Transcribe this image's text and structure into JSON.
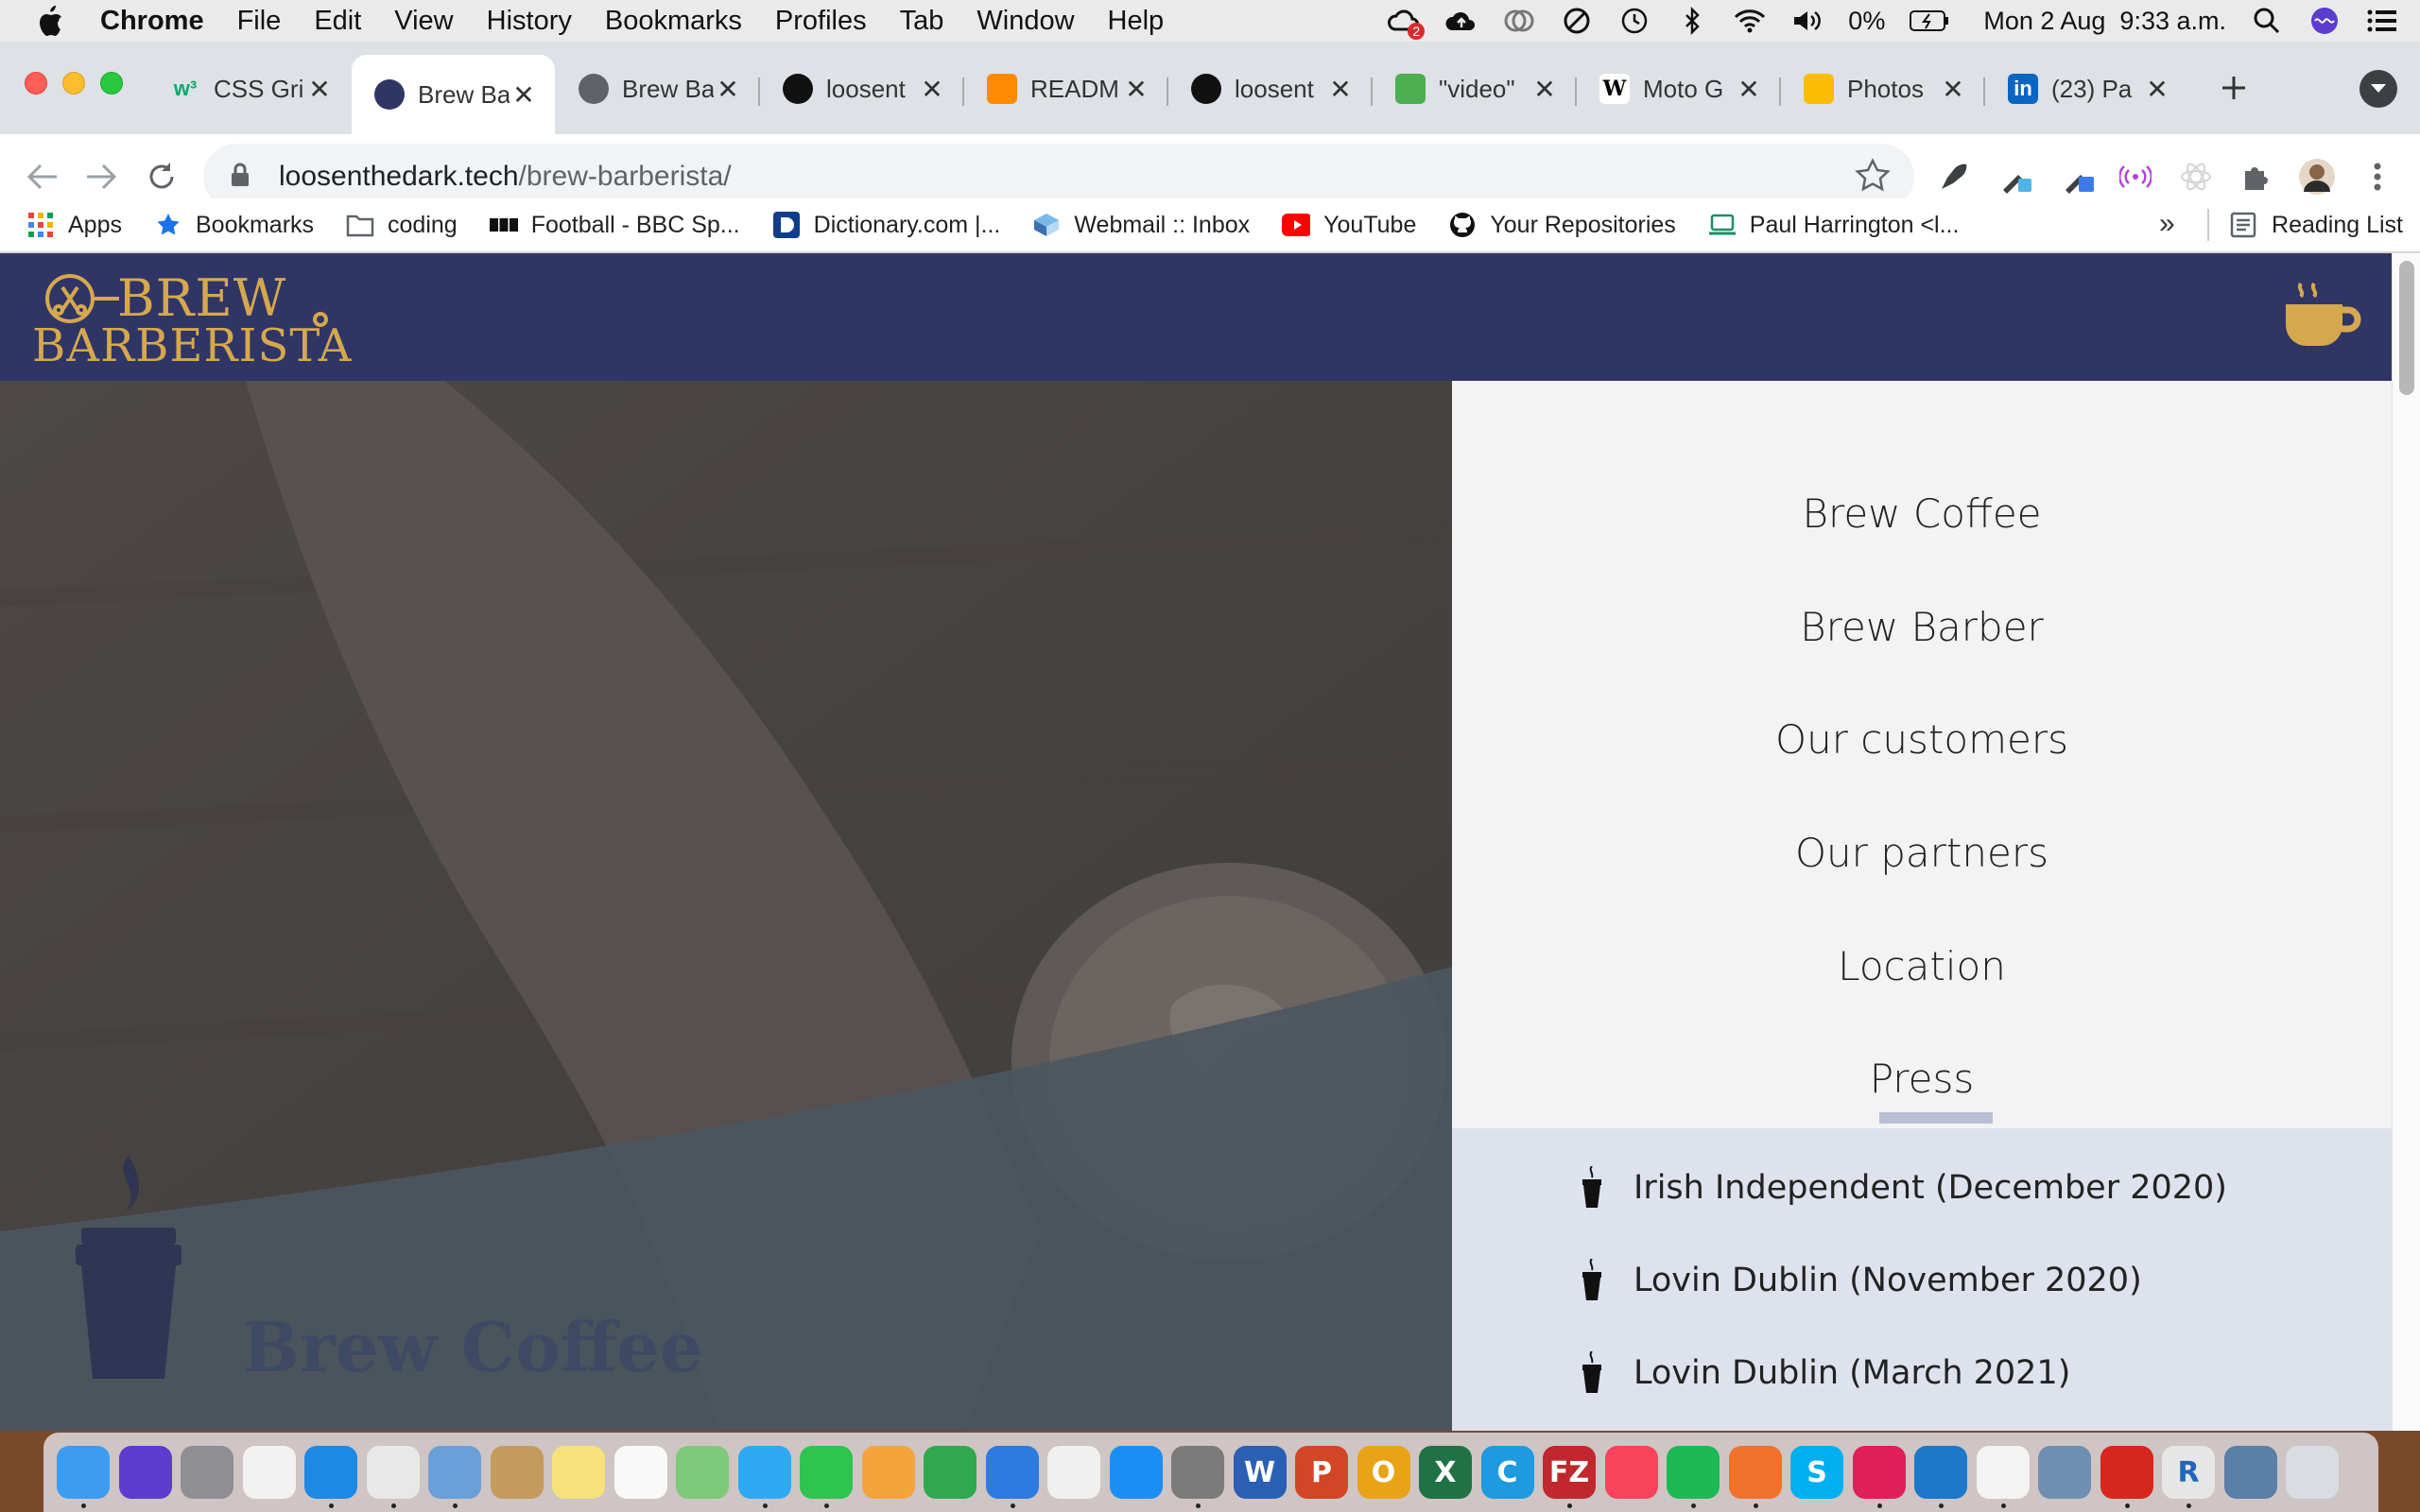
{
  "menubar": {
    "app_name": "Chrome",
    "items": [
      "File",
      "Edit",
      "View",
      "History",
      "Bookmarks",
      "Profiles",
      "Tab",
      "Window",
      "Help"
    ],
    "battery": "0%",
    "datetime": "Mon 2 Aug  9:33 a.m.",
    "cloud_badge": "2"
  },
  "tabs": [
    {
      "title": "CSS Gri",
      "favicon": "w3schools-icon",
      "favicon_text": "w³",
      "color": "#04aa6d",
      "active": false
    },
    {
      "title": "Brew Ba",
      "favicon": "brew-barberista-icon",
      "favicon_text": "",
      "color": "#2f3666",
      "active": true
    },
    {
      "title": "Brew Ba",
      "favicon": "globe-icon",
      "favicon_text": "",
      "color": "#5f6368",
      "active": false
    },
    {
      "title": "loosent",
      "favicon": "github-icon",
      "favicon_text": "",
      "color": "#111111",
      "active": false
    },
    {
      "title": "READM",
      "favicon": "gitpod-icon",
      "favicon_text": "",
      "color": "#ff8a00",
      "active": false
    },
    {
      "title": "loosent",
      "favicon": "github-icon",
      "favicon_text": "",
      "color": "#111111",
      "active": false
    },
    {
      "title": "\"video\"",
      "favicon": "chart-icon",
      "favicon_text": "",
      "color": "#4caf50",
      "active": false
    },
    {
      "title": "Moto G",
      "favicon": "wikipedia-icon",
      "favicon_text": "W",
      "color": "#ffffff",
      "active": false
    },
    {
      "title": "Photos",
      "favicon": "google-photos-icon",
      "favicon_text": "",
      "color": "#fbbc04",
      "active": false
    },
    {
      "title": "(23) Pa",
      "favicon": "linkedin-icon",
      "favicon_text": "in",
      "color": "#0a66c2",
      "active": false
    }
  ],
  "toolbar": {
    "url_host": "loosenthedark.tech",
    "url_path": "/brew-barberista/"
  },
  "bookmarks": [
    {
      "label": "Apps",
      "icon": "apps-grid-icon"
    },
    {
      "label": "Bookmarks",
      "icon": "star-icon"
    },
    {
      "label": "coding",
      "icon": "folder-icon"
    },
    {
      "label": "Football - BBC Sp...",
      "icon": "bbc-icon"
    },
    {
      "label": "Dictionary.com |...",
      "icon": "dictionary-icon"
    },
    {
      "label": "Webmail :: Inbox",
      "icon": "webmail-icon"
    },
    {
      "label": "YouTube",
      "icon": "youtube-icon"
    },
    {
      "label": "Your Repositories",
      "icon": "github-icon"
    },
    {
      "label": "Paul Harrington <l...",
      "icon": "laptop-icon"
    }
  ],
  "bookmarks_overflow": "»",
  "reading_list": "Reading List",
  "site": {
    "logo_line1": "BREW",
    "logo_line2": "BARBERISTA",
    "hero_title": "Brew Coffee",
    "nav": [
      "Brew Coffee",
      "Brew Barber",
      "Our customers",
      "Our partners",
      "Location",
      "Press"
    ],
    "press_items": [
      "Irish Independent (December 2020)",
      "Lovin Dublin (November 2020)",
      "Lovin Dublin (March 2021)"
    ],
    "colors": {
      "header_bg": "#2f3666",
      "gold": "#d6a84e",
      "panel_bg": "#f3f3f3",
      "press_bg": "#dde2ec"
    }
  },
  "dock": [
    {
      "name": "finder",
      "label": "",
      "color": "#3b9cf0"
    },
    {
      "name": "siri",
      "label": "",
      "color": "#5b3ccf"
    },
    {
      "name": "launchpad",
      "label": "",
      "color": "#8e8e93"
    },
    {
      "name": "app-grid",
      "label": "",
      "color": "#f2f2f2"
    },
    {
      "name": "safari",
      "label": "",
      "color": "#1e88e5"
    },
    {
      "name": "chrome",
      "label": "",
      "color": "#e8e8e8"
    },
    {
      "name": "preview",
      "label": "",
      "color": "#6aa0d8"
    },
    {
      "name": "contacts",
      "label": "",
      "color": "#c69a5c"
    },
    {
      "name": "notes",
      "label": "",
      "color": "#f6e27a"
    },
    {
      "name": "reminders",
      "label": "",
      "color": "#f9f9f9"
    },
    {
      "name": "maps",
      "label": "",
      "color": "#7fc97a"
    },
    {
      "name": "messages",
      "label": "",
      "color": "#2fa9f5"
    },
    {
      "name": "facetime",
      "label": "",
      "color": "#2fc450"
    },
    {
      "name": "pages",
      "label": "",
      "color": "#f3a43b"
    },
    {
      "name": "numbers",
      "label": "",
      "color": "#2fa84f"
    },
    {
      "name": "keynote",
      "label": "",
      "color": "#2d7ae1"
    },
    {
      "name": "photos",
      "label": "",
      "color": "#f0f0f0"
    },
    {
      "name": "app-store",
      "label": "",
      "color": "#1b8ef5"
    },
    {
      "name": "system-preferences",
      "label": "",
      "color": "#7b7b7b"
    },
    {
      "name": "word",
      "label": "W",
      "color": "#2b5fb4"
    },
    {
      "name": "powerpoint",
      "label": "P",
      "color": "#d24625"
    },
    {
      "name": "outlook",
      "label": "O",
      "color": "#e8a317"
    },
    {
      "name": "excel",
      "label": "X",
      "color": "#1f7244"
    },
    {
      "name": "cursor-c",
      "label": "C",
      "color": "#1e9be0"
    },
    {
      "name": "filezilla",
      "label": "FZ",
      "color": "#c0282d"
    },
    {
      "name": "music",
      "label": "",
      "color": "#f7435c"
    },
    {
      "name": "spotify",
      "label": "",
      "color": "#1db954"
    },
    {
      "name": "firefox",
      "label": "",
      "color": "#f1712b"
    },
    {
      "name": "skype",
      "label": "S",
      "color": "#00aff0"
    },
    {
      "name": "slack",
      "label": "",
      "color": "#e01e5a"
    },
    {
      "name": "vscode",
      "label": "",
      "color": "#1c78c8"
    },
    {
      "name": "textedit",
      "label": "",
      "color": "#f3f3f3"
    },
    {
      "name": "image-capture",
      "label": "",
      "color": "#6f8fb0"
    },
    {
      "name": "acrobat",
      "label": "",
      "color": "#d7261d"
    },
    {
      "name": "r-lang",
      "label": "R",
      "color": "#e6e6e6"
    },
    {
      "name": "archive",
      "label": "",
      "color": "#5a7fa8"
    },
    {
      "name": "trash",
      "label": "",
      "color": "#d9dde2"
    }
  ]
}
